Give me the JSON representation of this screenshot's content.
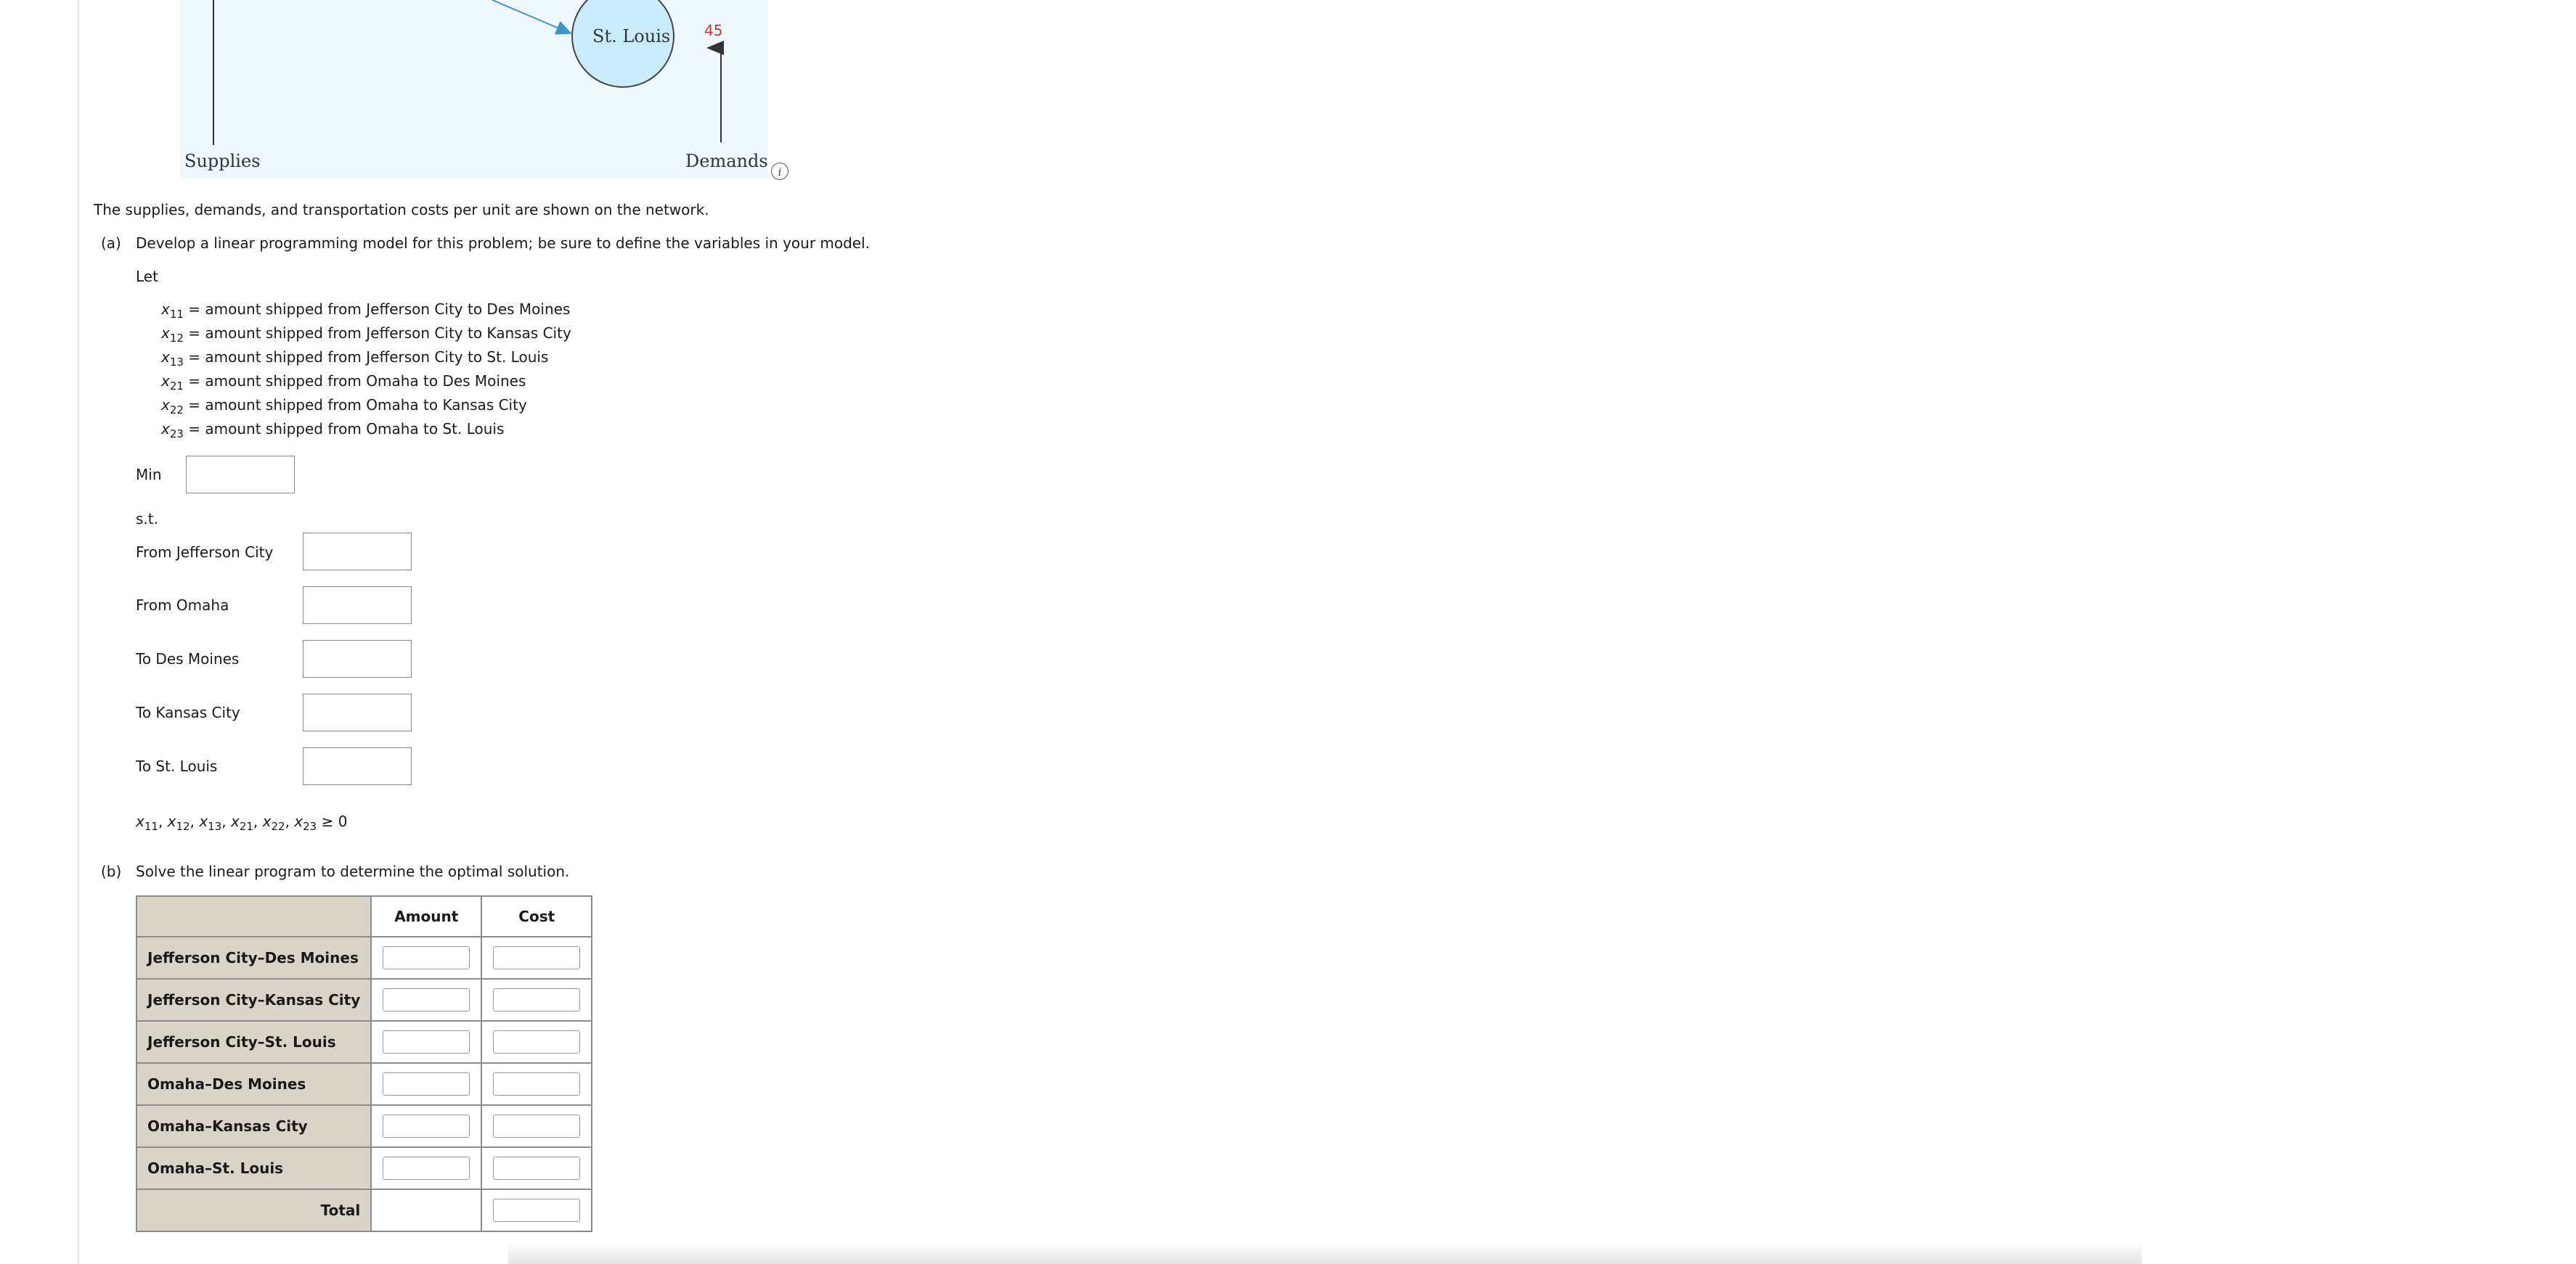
{
  "diagram": {
    "node_label": "St. Louis",
    "demand_value": "45",
    "supplies_label": "Supplies",
    "demands_label": "Demands",
    "colors": {
      "node_fill": "#c9ecfb",
      "arrow": "#3d95c9",
      "demand": "#c0392b"
    }
  },
  "intro_text": "The supplies, demands, and transportation costs per unit are shown on the network.",
  "part_a": {
    "marker": "(a)",
    "prompt": "Develop a linear programming model for this problem; be sure to define the variables in your model.",
    "let_label": "Let",
    "variables": [
      {
        "sym": "x",
        "sub": "11",
        "def": " = amount shipped from Jefferson City to Des Moines"
      },
      {
        "sym": "x",
        "sub": "12",
        "def": " = amount shipped from Jefferson City to Kansas City"
      },
      {
        "sym": "x",
        "sub": "13",
        "def": " = amount shipped from Jefferson City to St. Louis"
      },
      {
        "sym": "x",
        "sub": "21",
        "def": " = amount shipped from Omaha to Des Moines"
      },
      {
        "sym": "x",
        "sub": "22",
        "def": " = amount shipped from Omaha to Kansas City"
      },
      {
        "sym": "x",
        "sub": "23",
        "def": " = amount shipped from Omaha to St. Louis"
      }
    ],
    "min_label": "Min",
    "st_label": "s.t.",
    "constraints": [
      "From Jefferson City",
      "From Omaha",
      "To Des Moines",
      "To Kansas City",
      "To St. Louis"
    ],
    "nonneg_suffix": " ≥ 0"
  },
  "part_b": {
    "marker": "(b)",
    "prompt": "Solve the linear program to determine the optimal solution.",
    "headers": {
      "amount": "Amount",
      "cost": "Cost"
    },
    "rows": [
      "Jefferson City–Des Moines",
      "Jefferson City–Kansas City",
      "Jefferson City–St. Louis",
      "Omaha–Des Moines",
      "Omaha–Kansas City",
      "Omaha–St. Louis"
    ],
    "total_label": "Total"
  }
}
